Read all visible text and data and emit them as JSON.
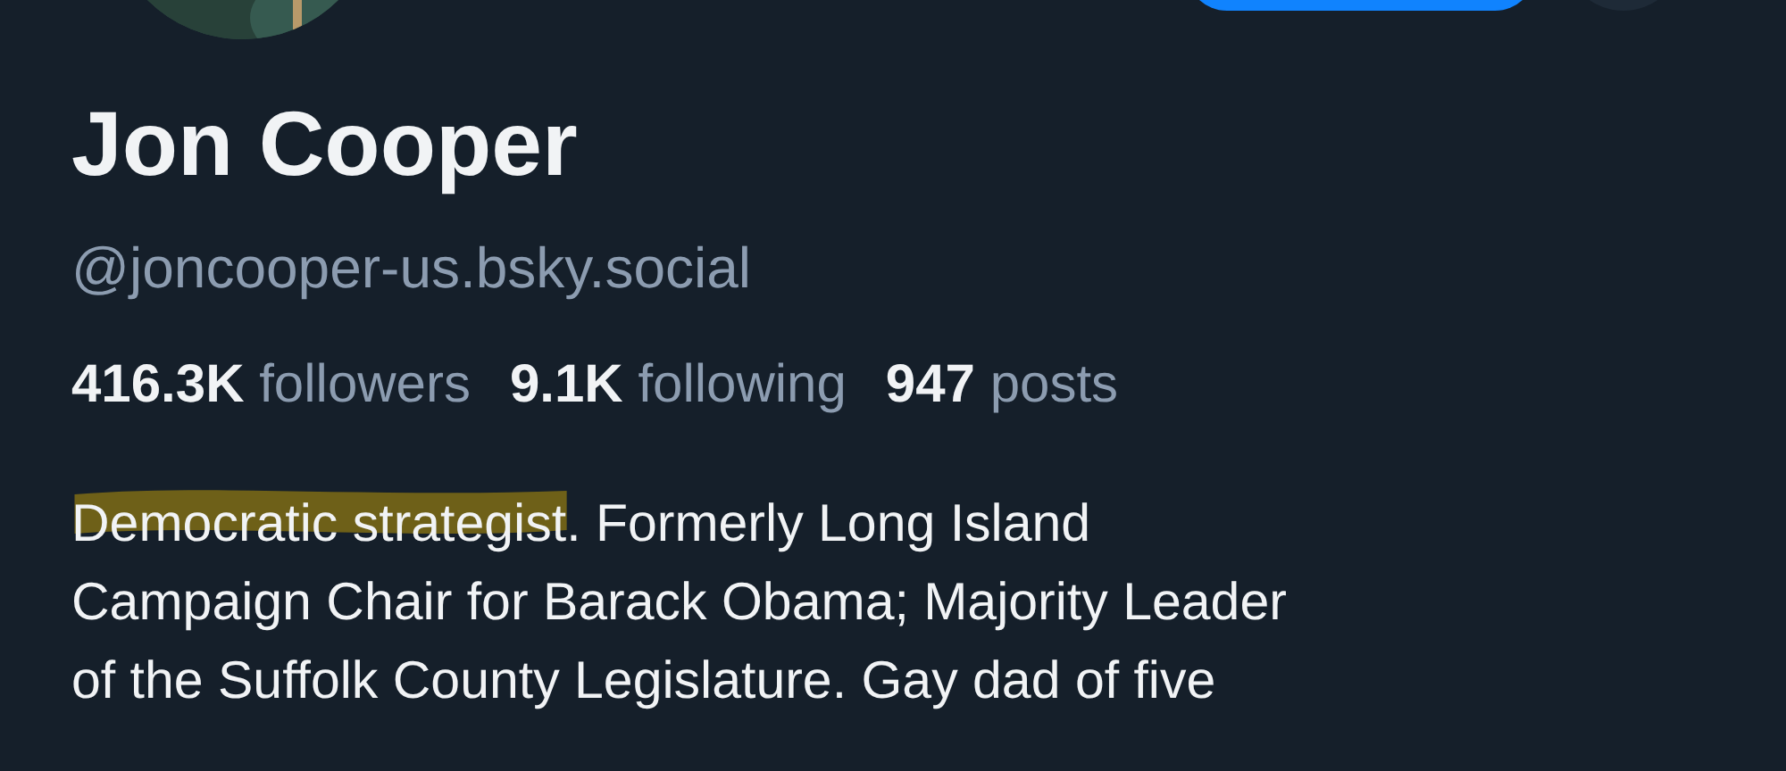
{
  "profile": {
    "display_name": "Jon Cooper",
    "handle": "@joncooper-us.bsky.social",
    "stats": [
      {
        "count": "416.3K",
        "label": "followers"
      },
      {
        "count": "9.1K",
        "label": "following"
      },
      {
        "count": "947",
        "label": "posts"
      }
    ],
    "bio": {
      "highlighted": "Democratic strategist",
      "lines": [
        ". Formerly Long Island",
        "Campaign Chair for Barack Obama; Majority Leader",
        "of the Suffolk County Legislature. Gay dad of five"
      ]
    }
  }
}
